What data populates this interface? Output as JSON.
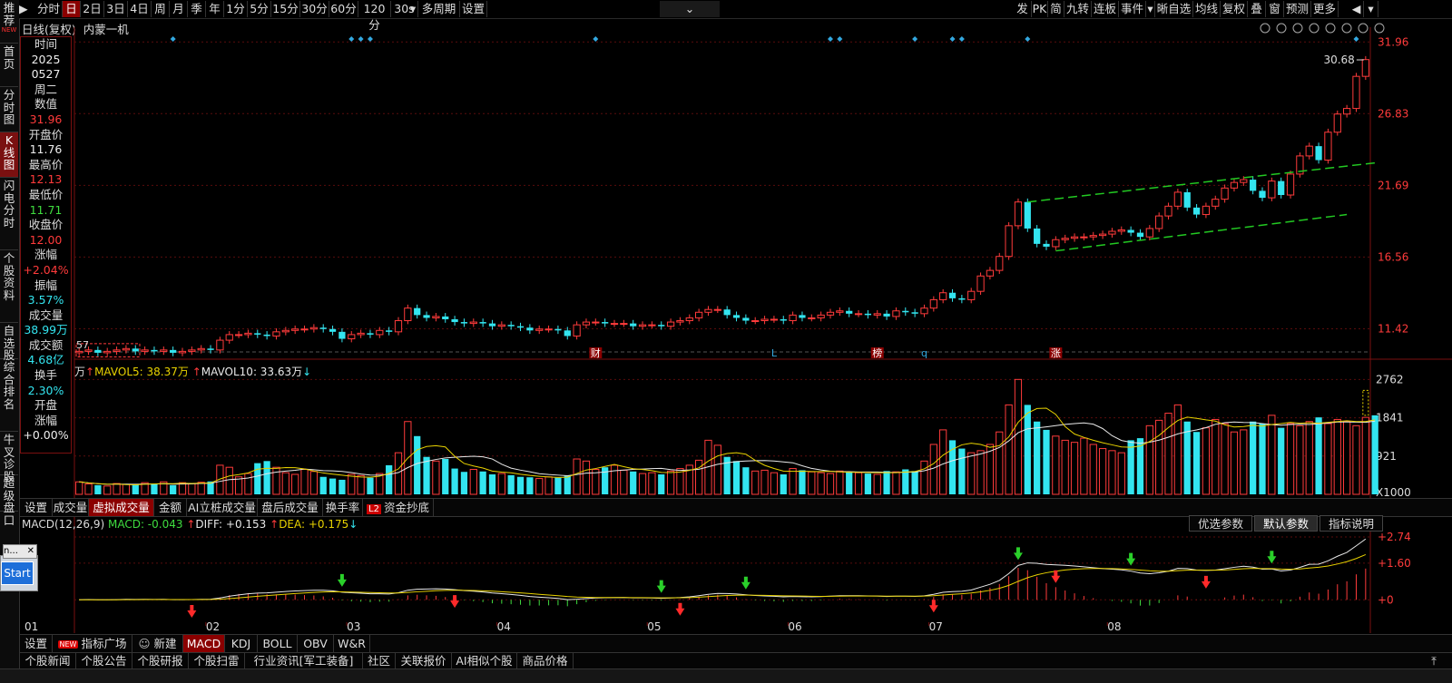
{
  "left_nav": [
    {
      "label": "推荐",
      "badge": "NEW"
    },
    {
      "label": "首页"
    },
    {
      "label": "分时图"
    },
    {
      "label": "K线图",
      "active": true
    },
    {
      "label": "闪电分时"
    },
    {
      "label": "个股资料"
    },
    {
      "label": "自选股"
    },
    {
      "label": "综合排名"
    },
    {
      "label": "牛叉诊股"
    },
    {
      "label": "超级盘口"
    }
  ],
  "toolbar": {
    "left_items": [
      "分时",
      "日",
      "2日",
      "3日",
      "4日",
      "周",
      "月",
      "季",
      "年",
      "1分",
      "5分",
      "15分",
      "30分",
      "60分",
      "120分",
      "30s",
      "多周期",
      "设置"
    ],
    "active_item": "日",
    "right_items": [
      "发",
      "PK",
      "简",
      "九转",
      "连板",
      "事件",
      "晰自选",
      "均线",
      "复权",
      "叠",
      "窗",
      "预测",
      "更多"
    ]
  },
  "chart_header": {
    "title": "日线(复权)",
    "stock_name": "内蒙一机"
  },
  "info_panel": {
    "time_label": "时间",
    "date_year": "2025",
    "date_md": "0527",
    "weekday": "周二",
    "value_label": "数值",
    "value": "31.96",
    "open_label": "开盘价",
    "open": "11.76",
    "high_label": "最高价",
    "high": "12.13",
    "low_label": "最低价",
    "low": "11.71",
    "close_label": "收盘价",
    "close": "12.00",
    "change_label": "涨幅",
    "change": "+2.04%",
    "amplitude_label": "振幅",
    "amplitude": "3.57%",
    "volume_label": "成交量",
    "volume": "38.99万",
    "amount_label": "成交额",
    "amount": "4.68亿",
    "turnover_label": "换手",
    "turnover": "2.30%",
    "open_change_label_1": "开盘",
    "open_change_label_2": "涨幅",
    "open_change": "+0.00%"
  },
  "price_axis": [
    "31.96",
    "26.83",
    "21.69",
    "16.56",
    "11.42"
  ],
  "last_price_label": "30.68",
  "low_mark_label": "57",
  "event_markers": [
    "财",
    "L",
    "榜",
    "q",
    "涨"
  ],
  "volume_legend": {
    "unit": "万",
    "mavol5": "MAVOL5: 38.37万",
    "mavol10": "MAVOL10: 33.63万"
  },
  "volume_axis": [
    "2762",
    "1841",
    "921",
    "X1000"
  ],
  "volume_tabs": [
    "设置",
    "成交量",
    "虚拟成交量",
    "金额",
    "AI立桩成交量",
    "盘后成交量",
    "换手率",
    "资金抄底"
  ],
  "volume_tabs_active": "虚拟成交量",
  "volume_tab_l2": "L2",
  "macd_legend": {
    "name": "MACD(12,26,9)",
    "macd": "MACD: -0.043",
    "diff": "DIFF: +0.153",
    "dea": "DEA: +0.175"
  },
  "macd_buttons": [
    "优选参数",
    "默认参数",
    "指标说明"
  ],
  "macd_axis": [
    "+2.74",
    "+1.60",
    "+0"
  ],
  "month_labels": [
    "01",
    "02",
    "03",
    "04",
    "05",
    "06",
    "07",
    "08"
  ],
  "indicator_tabs": [
    "设置",
    "指标广场",
    "新建",
    "MACD",
    "KDJ",
    "BOLL",
    "OBV",
    "W&R"
  ],
  "indicator_tabs_active": "MACD",
  "news_tabs": [
    "个股新闻",
    "个股公告",
    "个股研报",
    "个股扫雷",
    "行业资讯[军工装备]",
    "社区",
    "关联报价",
    "AI相似个股",
    "商品价格"
  ],
  "popup": {
    "text": "n...",
    "button": "Start"
  },
  "colors": {
    "up": "#ff3b3b",
    "down": "#33e5f0",
    "ma_white": "#e8e8e8",
    "ma_yellow": "#e8d200",
    "channel": "#22c922",
    "active_tab": "#8b0000"
  },
  "chart_data": {
    "type": "candlestick",
    "title": "内蒙一机",
    "y_range": [
      9.5,
      32.5
    ],
    "months": [
      "01",
      "02",
      "03",
      "04",
      "05",
      "06",
      "07",
      "08"
    ],
    "closes": [
      9.8,
      9.9,
      9.7,
      9.8,
      9.9,
      10.0,
      9.8,
      9.9,
      9.8,
      9.9,
      9.7,
      9.8,
      9.9,
      10.0,
      9.9,
      10.6,
      11.0,
      11.0,
      11.1,
      11.0,
      10.9,
      11.2,
      11.3,
      11.4,
      11.4,
      11.5,
      11.4,
      11.2,
      10.7,
      11.0,
      11.1,
      11.0,
      11.3,
      11.2,
      12.0,
      12.9,
      12.4,
      12.2,
      12.3,
      12.1,
      11.9,
      11.8,
      11.9,
      11.8,
      11.6,
      11.7,
      11.6,
      11.5,
      11.3,
      11.4,
      11.4,
      11.3,
      10.9,
      11.7,
      11.9,
      11.9,
      11.8,
      11.8,
      11.8,
      11.6,
      11.7,
      11.7,
      11.6,
      11.9,
      12.0,
      12.2,
      12.6,
      12.8,
      12.8,
      12.4,
      12.2,
      12.0,
      12.0,
      12.1,
      12.1,
      12.0,
      12.4,
      12.2,
      12.2,
      12.4,
      12.6,
      12.7,
      12.5,
      12.5,
      12.4,
      12.5,
      12.3,
      12.7,
      12.6,
      12.5,
      12.9,
      13.5,
      14.0,
      13.6,
      13.5,
      14.1,
      15.2,
      15.6,
      16.6,
      18.8,
      20.5,
      18.6,
      17.5,
      17.3,
      17.8,
      17.9,
      18.0,
      18.0,
      18.1,
      18.2,
      18.4,
      18.5,
      18.3,
      18.0,
      18.6,
      19.5,
      20.2,
      21.2,
      20.1,
      19.6,
      20.2,
      20.7,
      21.5,
      21.9,
      22.1,
      21.3,
      20.8,
      22.0,
      21.0,
      22.5,
      23.8,
      24.5,
      23.5,
      25.5,
      26.8,
      27.2,
      29.5,
      30.7
    ],
    "volumes_k": [
      300,
      250,
      220,
      200,
      260,
      240,
      230,
      280,
      250,
      300,
      220,
      280,
      260,
      290,
      310,
      700,
      650,
      420,
      500,
      750,
      800,
      650,
      520,
      480,
      600,
      550,
      420,
      380,
      350,
      480,
      450,
      400,
      500,
      700,
      1000,
      1750,
      1400,
      900,
      800,
      850,
      620,
      540,
      600,
      550,
      480,
      500,
      460,
      420,
      410,
      380,
      420,
      400,
      450,
      850,
      800,
      600,
      650,
      700,
      580,
      550,
      500,
      520,
      480,
      560,
      620,
      700,
      820,
      1300,
      1180,
      900,
      800,
      650,
      560,
      580,
      520,
      480,
      620,
      580,
      540,
      520,
      500,
      560,
      540,
      520,
      500,
      480,
      560,
      540,
      600,
      560,
      800,
      1200,
      1550,
      1300,
      1100,
      1000,
      1050,
      1200,
      1500,
      2150,
      2762,
      2150,
      1750,
      1550,
      1400,
      1300,
      1250,
      1350,
      1200,
      1100,
      1050,
      1000,
      1300,
      1350,
      1650,
      1780,
      1950,
      2150,
      1750,
      1500,
      1600,
      1800,
      1700,
      1500,
      1550,
      1750,
      1700,
      1900,
      1600,
      1700,
      1650,
      1750,
      1850,
      1700,
      1800,
      1750,
      1650,
      1850,
      1900
    ]
  }
}
